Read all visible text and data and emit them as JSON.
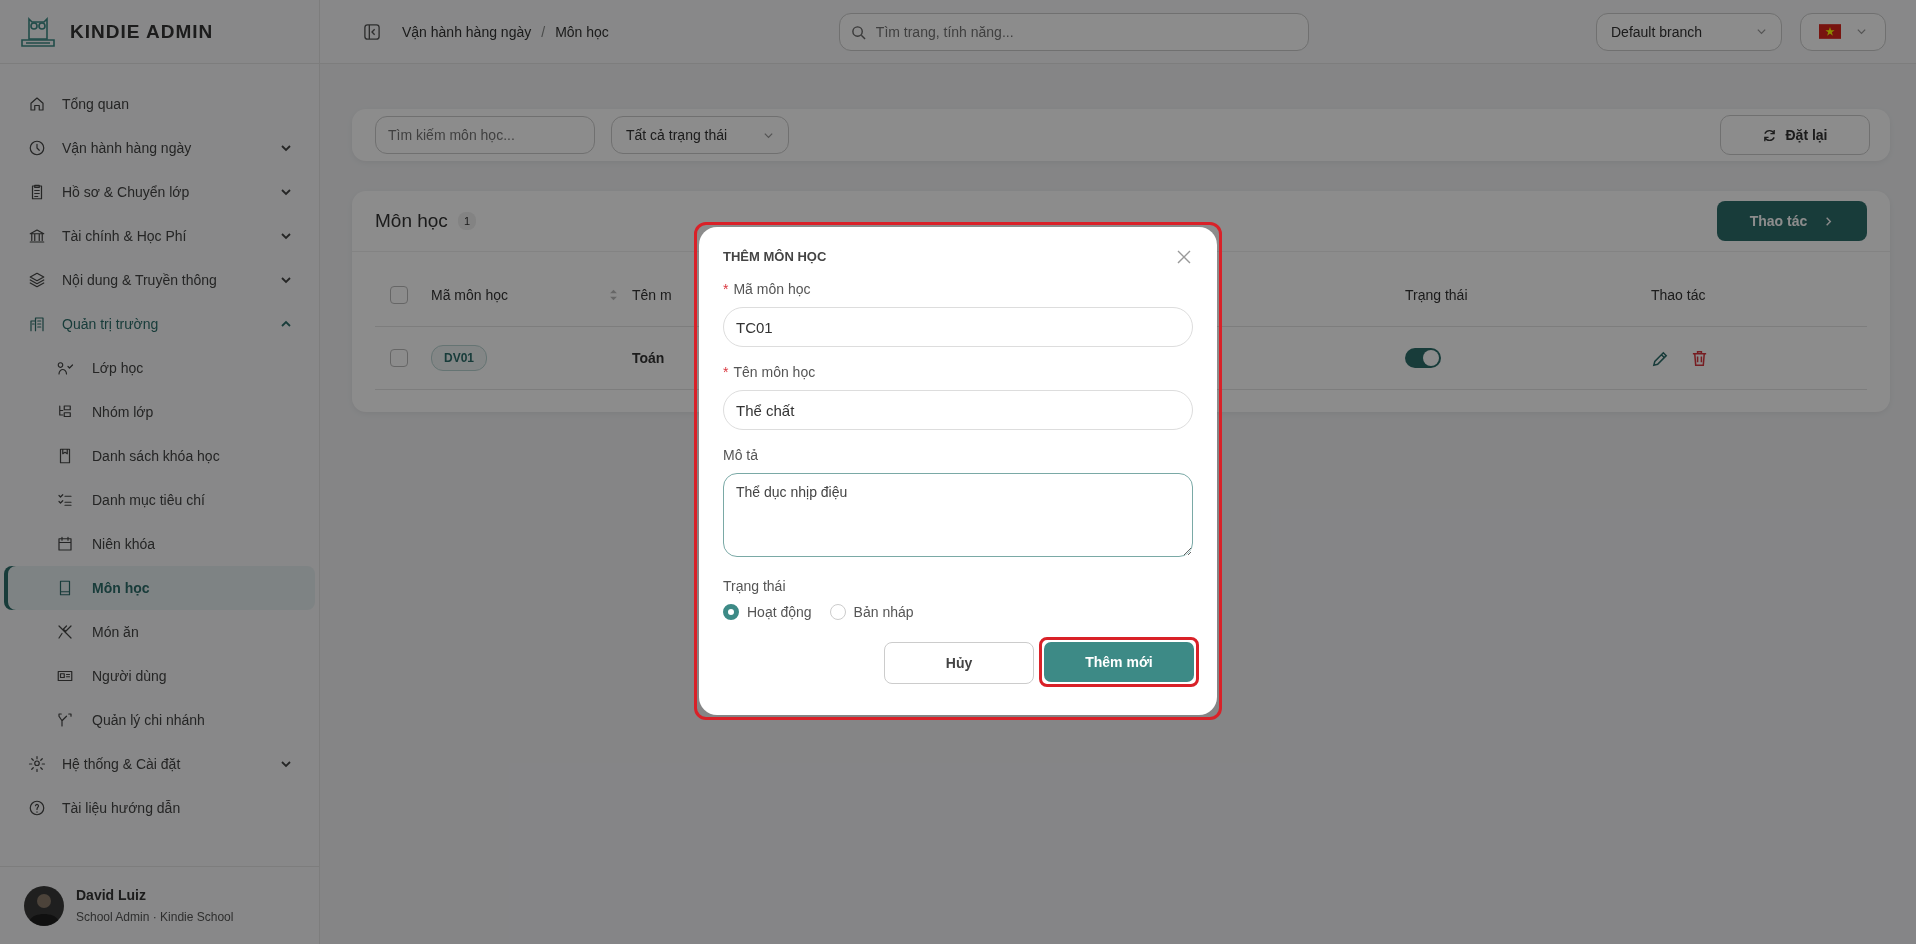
{
  "brand": {
    "name": "KINDIE ADMIN"
  },
  "sidebar": {
    "items": [
      {
        "label": "Tổng quan"
      },
      {
        "label": "Vận hành hàng ngày",
        "expanded": false
      },
      {
        "label": "Hồ sơ & Chuyển lớp",
        "expanded": false
      },
      {
        "label": "Tài chính & Học Phí",
        "expanded": false
      },
      {
        "label": "Nội dung & Truyền thông",
        "expanded": false
      },
      {
        "label": "Quản trị trường",
        "expanded": true,
        "children": [
          {
            "label": "Lớp học",
            "selected": false
          },
          {
            "label": "Nhóm lớp",
            "selected": false
          },
          {
            "label": "Danh sách khóa học",
            "selected": false
          },
          {
            "label": "Danh mục tiêu chí",
            "selected": false
          },
          {
            "label": "Niên khóa",
            "selected": false
          },
          {
            "label": "Môn học",
            "selected": true
          },
          {
            "label": "Món ăn",
            "selected": false
          },
          {
            "label": "Người dùng",
            "selected": false
          },
          {
            "label": "Quản lý chi nhánh",
            "selected": false
          }
        ]
      },
      {
        "label": "Hệ thống & Cài đặt",
        "expanded": false
      },
      {
        "label": "Tài liệu hướng dẫn"
      }
    ]
  },
  "user": {
    "name": "David Luiz",
    "role": "School Admin · Kindie School"
  },
  "topbar": {
    "breadcrumb": [
      "Vận hành hàng ngày",
      "Môn học"
    ],
    "separator": "/",
    "search": {
      "placeholder": "Tìm trang, tính năng..."
    },
    "branch": "Default branch"
  },
  "filters": {
    "search": {
      "placeholder": "Tìm kiếm môn học..."
    },
    "status": "Tất cả trạng thái",
    "reset": "Đặt lại"
  },
  "table": {
    "title": "Môn học",
    "count": "1",
    "action": "Thao tác",
    "select_all_checked": false,
    "columns": [
      "Mã môn học",
      "Tên m",
      "Trạng thái",
      "Thao tác"
    ],
    "rows": [
      {
        "checked": false,
        "code": "DV01",
        "name": "Toán",
        "on": true
      }
    ]
  },
  "modal": {
    "title": "THÊM MÔN HỌC",
    "fields": [
      {
        "kind": "input",
        "required_mark": "*",
        "label": "Mã môn học",
        "value": "TC01"
      },
      {
        "kind": "input",
        "required_mark": "*",
        "label": "Tên môn học",
        "value": "Thể chất"
      },
      {
        "kind": "textarea",
        "label": "Mô tả",
        "value": "Thể dục nhịp điệu"
      }
    ],
    "status_label": "Trạng thái",
    "options": [
      {
        "label": "Hoạt động",
        "selected": true
      },
      {
        "label": "Bản nháp",
        "selected": false
      }
    ],
    "cancel": "Hủy",
    "submit": "Thêm mới"
  }
}
